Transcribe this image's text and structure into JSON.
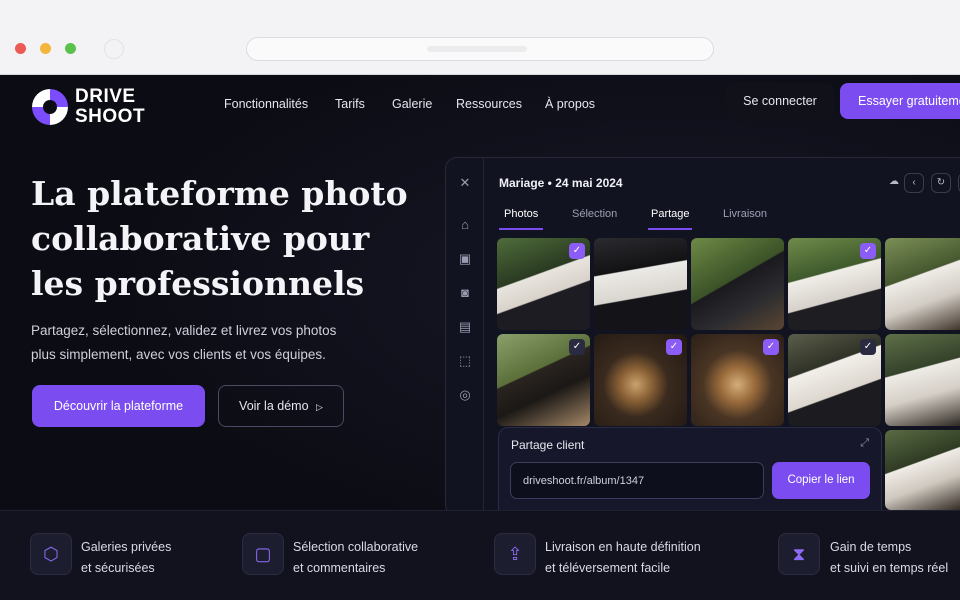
{
  "brand": {
    "line1": "DRIVE",
    "line2": "SHOOT"
  },
  "nav": {
    "items": [
      "Fonctionnalités",
      "Tarifs",
      "Galerie",
      "Ressources",
      "À propos"
    ],
    "login": "Se connecter",
    "trial": "Essayer gratuitement"
  },
  "hero": {
    "title_lines": [
      "La plateforme photo",
      "collaborative pour",
      "les professionnels"
    ],
    "subtitle_lines": [
      "Partagez, sélectionnez, validez et livrez vos photos",
      "plus simplement, avec vos clients et vos équipes."
    ],
    "cta_primary": "Découvrir la plateforme",
    "cta_secondary": "Voir la démo"
  },
  "app": {
    "title": "Mariage • 24 mai 2024",
    "tabs": [
      "Photos",
      "Sélection",
      "Partage",
      "Livraison"
    ],
    "active_tabs": [
      "Photos",
      "Partage"
    ],
    "share": {
      "title": "Partage client",
      "link": "driveshoot.fr/album/1347",
      "copy_label": "Copier le lien"
    }
  },
  "features": [
    {
      "line1": "Galeries privées",
      "line2": "et sécurisées",
      "icon": "gallery-lock-icon"
    },
    {
      "line1": "Sélection collaborative",
      "line2": "et commentaires",
      "icon": "comment-icon"
    },
    {
      "line1": "Livraison en haute définition",
      "line2": "et téléversement facile",
      "icon": "upload-icon"
    },
    {
      "line1": "Gain de temps",
      "line2": "et suivi en temps réel",
      "icon": "hourglass-icon"
    }
  ],
  "colors": {
    "accent": "#7b4df0",
    "background": "#0c0c14"
  }
}
